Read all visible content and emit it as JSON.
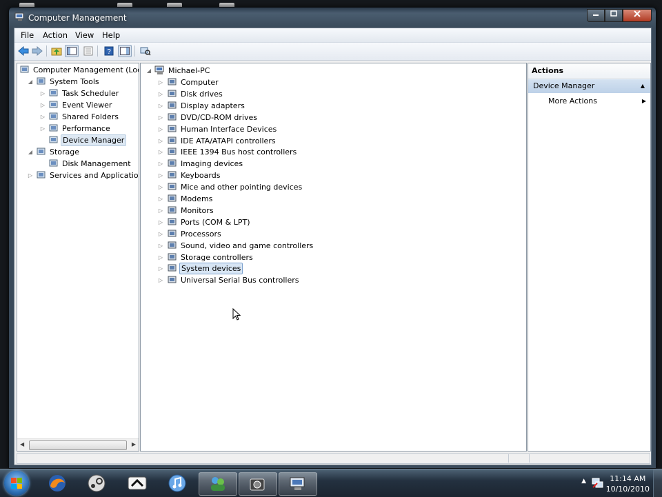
{
  "window": {
    "title": "Computer Management"
  },
  "menu": [
    "File",
    "Action",
    "View",
    "Help"
  ],
  "left_tree": [
    {
      "label": "Computer Management (Local",
      "expander": "",
      "icon": "computer-management-icon",
      "level": 0
    },
    {
      "label": "System Tools",
      "expander": "◢",
      "icon": "system-tools-icon",
      "level": 1
    },
    {
      "label": "Task Scheduler",
      "expander": "▷",
      "icon": "clock-icon",
      "level": 2
    },
    {
      "label": "Event Viewer",
      "expander": "▷",
      "icon": "event-viewer-icon",
      "level": 2
    },
    {
      "label": "Shared Folders",
      "expander": "▷",
      "icon": "shared-folders-icon",
      "level": 2
    },
    {
      "label": "Performance",
      "expander": "▷",
      "icon": "performance-icon",
      "level": 2
    },
    {
      "label": "Device Manager",
      "expander": "",
      "icon": "device-manager-icon",
      "level": 2,
      "selected": true
    },
    {
      "label": "Storage",
      "expander": "◢",
      "icon": "storage-icon",
      "level": 1
    },
    {
      "label": "Disk Management",
      "expander": "",
      "icon": "disk-management-icon",
      "level": 2
    },
    {
      "label": "Services and Applications",
      "expander": "▷",
      "icon": "services-icon",
      "level": 1
    }
  ],
  "device_tree": {
    "root": "Michael-PC",
    "items": [
      {
        "label": "Computer",
        "icon": "computer-icon"
      },
      {
        "label": "Disk drives",
        "icon": "disk-drive-icon"
      },
      {
        "label": "Display adapters",
        "icon": "display-adapter-icon"
      },
      {
        "label": "DVD/CD-ROM drives",
        "icon": "dvd-drive-icon"
      },
      {
        "label": "Human Interface Devices",
        "icon": "hid-icon"
      },
      {
        "label": "IDE ATA/ATAPI controllers",
        "icon": "ide-controller-icon"
      },
      {
        "label": "IEEE 1394 Bus host controllers",
        "icon": "ieee1394-icon"
      },
      {
        "label": "Imaging devices",
        "icon": "imaging-device-icon"
      },
      {
        "label": "Keyboards",
        "icon": "keyboard-icon"
      },
      {
        "label": "Mice and other pointing devices",
        "icon": "mouse-icon"
      },
      {
        "label": "Modems",
        "icon": "modem-icon"
      },
      {
        "label": "Monitors",
        "icon": "monitor-icon"
      },
      {
        "label": "Ports (COM & LPT)",
        "icon": "port-icon"
      },
      {
        "label": "Processors",
        "icon": "processor-icon"
      },
      {
        "label": "Sound, video and game controllers",
        "icon": "sound-icon"
      },
      {
        "label": "Storage controllers",
        "icon": "storage-controller-icon"
      },
      {
        "label": "System devices",
        "icon": "system-devices-icon",
        "selected": true
      },
      {
        "label": "Universal Serial Bus controllers",
        "icon": "usb-icon"
      }
    ]
  },
  "actions": {
    "header": "Actions",
    "section": "Device Manager",
    "more": "More Actions"
  },
  "taskbar": {
    "time": "11:14 AM",
    "date": "10/10/2010"
  },
  "colors": {
    "selection": "#d7e5f4",
    "actions_section": "#c8dbef"
  }
}
